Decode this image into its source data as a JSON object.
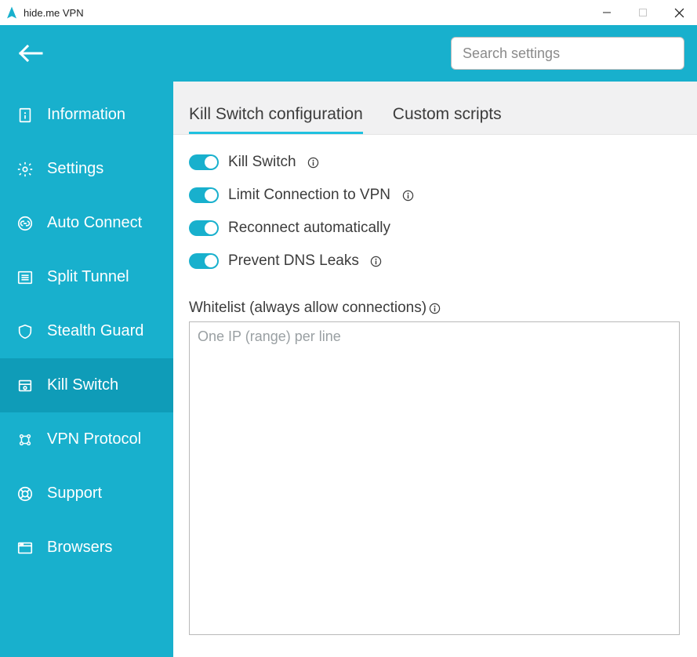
{
  "window": {
    "title": "hide.me VPN"
  },
  "header": {
    "search_placeholder": "Search settings"
  },
  "sidebar": {
    "items": [
      {
        "id": "information",
        "label": "Information",
        "icon": "info-file-icon",
        "active": false
      },
      {
        "id": "settings",
        "label": "Settings",
        "icon": "gear-icon",
        "active": false
      },
      {
        "id": "auto-connect",
        "label": "Auto Connect",
        "icon": "link-icon",
        "active": false
      },
      {
        "id": "split-tunnel",
        "label": "Split Tunnel",
        "icon": "list-icon",
        "active": false
      },
      {
        "id": "stealth-guard",
        "label": "Stealth Guard",
        "icon": "shield-icon",
        "active": false
      },
      {
        "id": "kill-switch",
        "label": "Kill Switch",
        "icon": "switch-icon",
        "active": true
      },
      {
        "id": "vpn-protocol",
        "label": "VPN Protocol",
        "icon": "protocol-icon",
        "active": false
      },
      {
        "id": "support",
        "label": "Support",
        "icon": "lifebuoy-icon",
        "active": false
      },
      {
        "id": "browsers",
        "label": "Browsers",
        "icon": "browser-icon",
        "active": false
      }
    ]
  },
  "tabs": [
    {
      "id": "kill-switch-config",
      "label": "Kill Switch configuration",
      "active": true
    },
    {
      "id": "custom-scripts",
      "label": "Custom scripts",
      "active": false
    }
  ],
  "toggles": [
    {
      "id": "kill-switch",
      "label": "Kill Switch",
      "on": true,
      "help": true
    },
    {
      "id": "limit-connection",
      "label": "Limit Connection to VPN",
      "on": true,
      "help": true
    },
    {
      "id": "reconnect-auto",
      "label": "Reconnect automatically",
      "on": true,
      "help": false
    },
    {
      "id": "prevent-dns-leaks",
      "label": "Prevent DNS Leaks",
      "on": true,
      "help": true
    }
  ],
  "whitelist": {
    "label": "Whitelist (always allow connections)",
    "placeholder": "One IP (range) per line",
    "value": ""
  }
}
